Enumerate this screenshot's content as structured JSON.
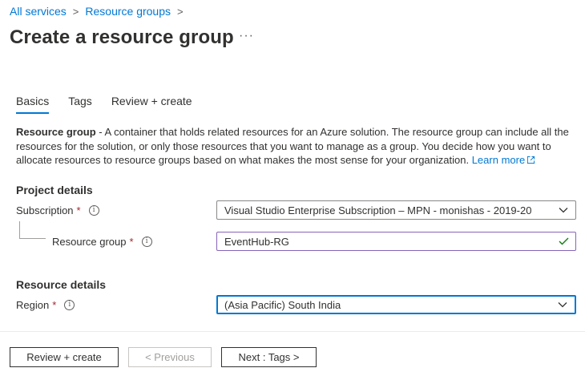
{
  "breadcrumb": {
    "items": [
      "All services",
      "Resource groups"
    ],
    "separator": ">"
  },
  "page": {
    "title": "Create a resource group",
    "more_label": "···"
  },
  "tabs": [
    {
      "label": "Basics",
      "active": true
    },
    {
      "label": "Tags",
      "active": false
    },
    {
      "label": "Review + create",
      "active": false
    }
  ],
  "description": {
    "term": "Resource group",
    "text": " - A container that holds related resources for an Azure solution. The resource group can include all the resources for the solution, or only those resources that you want to manage as a group. You decide how you want to allocate resources to resource groups based on what makes the most sense for your organization. ",
    "learn_more": "Learn more"
  },
  "project_details": {
    "header": "Project details",
    "subscription": {
      "label": "Subscription",
      "required_mark": "*",
      "value": "Visual Studio Enterprise Subscription – MPN - monishas - 2019-20"
    },
    "resource_group": {
      "label": "Resource group",
      "required_mark": "*",
      "value": "EventHub-RG"
    }
  },
  "resource_details": {
    "header": "Resource details",
    "region": {
      "label": "Region",
      "required_mark": "*",
      "value": "(Asia Pacific) South India"
    }
  },
  "info_glyph": "i",
  "footer": {
    "review_create": "Review + create",
    "previous": "< Previous",
    "next": "Next : Tags >"
  },
  "colors": {
    "accent": "#0078d4",
    "required": "#a4262c",
    "valid": "#107c10",
    "focus_purple": "#8764b8"
  }
}
